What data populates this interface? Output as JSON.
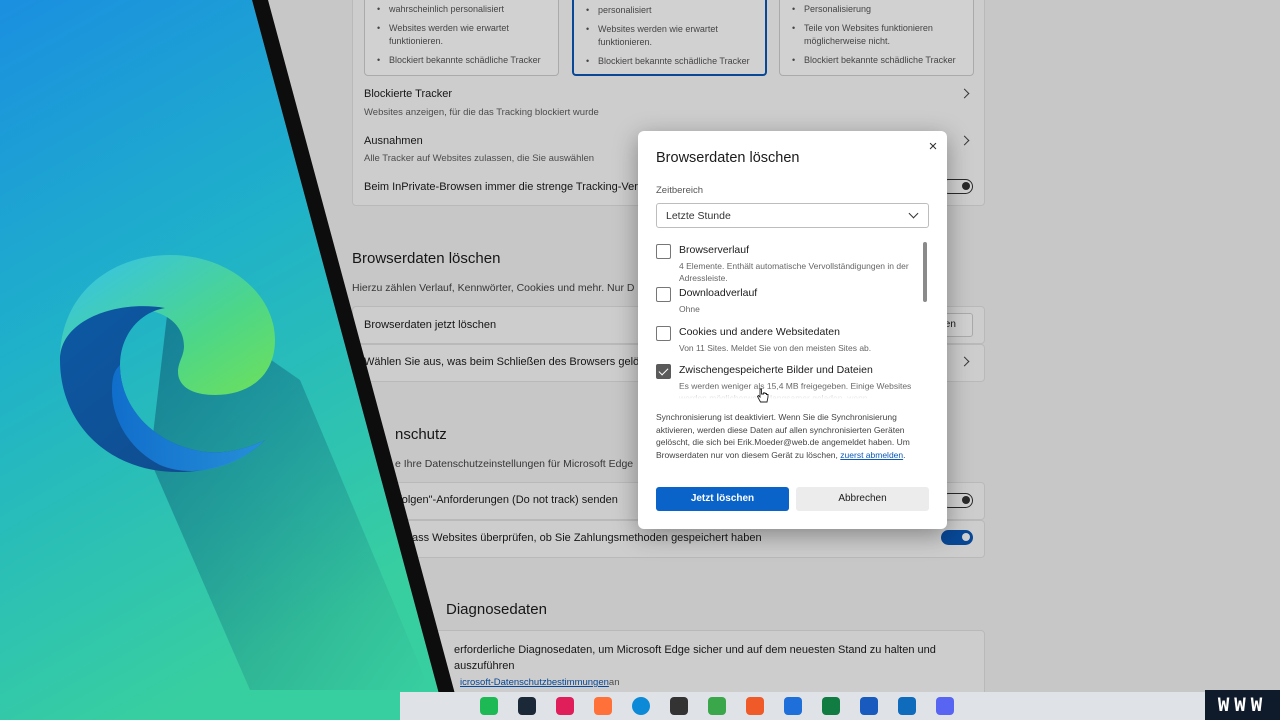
{
  "settings": {
    "levels": [
      {
        "bullets": [
          "wahrscheinlich personalisiert",
          "Websites werden wie erwartet funktionieren.",
          "Blockiert bekannte schädliche Tracker"
        ]
      },
      {
        "bullets": [
          "personalisiert",
          "Websites werden wie erwartet funktionieren.",
          "Blockiert bekannte schädliche Tracker"
        ]
      },
      {
        "bullets": [
          "Personalisierung",
          "Teile von Websites funktionieren möglicherweise nicht.",
          "Blockiert bekannte schädliche Tracker"
        ]
      }
    ],
    "blocked_trackers": {
      "title": "Blockierte Tracker",
      "sub": "Websites anzeigen, für die das Tracking blockiert wurde"
    },
    "exceptions": {
      "title": "Ausnahmen",
      "sub": "Alle Tracker auf Websites zulassen, die Sie auswählen"
    },
    "inprivate": "Beim InPrivate-Browsen immer die strenge Tracking-Ver",
    "clear_section": {
      "title": "Browserdaten löschen",
      "sub": "Hierzu zählen Verlauf, Kennwörter, Cookies und mehr. Nur D",
      "now": "Browserdaten jetzt löschen",
      "now_btn": "hlen",
      "on_close": "Wählen Sie aus, was beim Schließen des Browsers gelös"
    },
    "privacy_section": {
      "title": "nschutz",
      "sub": "e Ihre Datenschutzeinstellungen für Microsoft Edge",
      "dnt": "rfolgen\"-Anforderungen (Do not track) senden",
      "payment": "ass Websites überprüfen, ob Sie Zahlungsmethoden gespeichert haben"
    },
    "diag_section": {
      "title": "Diagnosedaten",
      "line1": "erforderliche Diagnosedaten, um Microsoft Edge sicher und auf dem neuesten Stand zu halten und",
      "line2": "auszuführen",
      "link": "icrosoft-Datenschutzbestimmungen",
      "link_tail": "an"
    }
  },
  "dialog": {
    "title": "Browserdaten löschen",
    "close_icon": "×",
    "time_label": "Zeitbereich",
    "time_value": "Letzte Stunde",
    "items": [
      {
        "title": "Browserverlauf",
        "desc": "4 Elemente. Enthält automatische Vervollständigungen in der Adressleiste.",
        "checked": false
      },
      {
        "title": "Downloadverlauf",
        "desc": "Ohne",
        "checked": false
      },
      {
        "title": "Cookies und andere Websitedaten",
        "desc": "Von 11 Sites. Meldet Sie von den meisten Sites ab.",
        "checked": false
      },
      {
        "title": "Zwischengespeicherte Bilder und Dateien",
        "desc": "Es werden weniger als 15,4 MB freigegeben. Einige Websites werden möglicherweise langsamer geladen, wenn",
        "checked": true
      }
    ],
    "sync_text": "Synchronisierung ist deaktiviert. Wenn Sie die Synchronisierung aktivieren, werden diese Daten auf allen synchronisierten Geräten gelöscht, die sich bei Erik.Moeder@web.de angemeldet haben. Um Browserdaten nur von diesem Gerät zu löschen,",
    "sync_link": "zuerst abmelden",
    "sync_end": ".",
    "primary": "Jetzt löschen",
    "secondary": "Abbrechen"
  },
  "taskbar": {
    "icons": [
      {
        "name": "spotify-icon",
        "color": "#1db954"
      },
      {
        "name": "steam-icon",
        "color": "#1b2838"
      },
      {
        "name": "slack-icon",
        "color": "#e01e5a"
      },
      {
        "name": "firefox-icon",
        "color": "#ff7139"
      },
      {
        "name": "edge-icon",
        "color": "#0c8ad8"
      },
      {
        "name": "inkscape-icon",
        "color": "#333333"
      },
      {
        "name": "camtasia-icon",
        "color": "#3aa84a"
      },
      {
        "name": "c-app-icon",
        "color": "#f05a28"
      },
      {
        "name": "headphones-icon",
        "color": "#1e6fd9"
      },
      {
        "name": "excel-icon",
        "color": "#107c41"
      },
      {
        "name": "word-icon",
        "color": "#185abd"
      },
      {
        "name": "outlook-icon",
        "color": "#0f6cbd"
      },
      {
        "name": "discord-icon",
        "color": "#5865f2"
      }
    ]
  },
  "watermark": "WWW"
}
